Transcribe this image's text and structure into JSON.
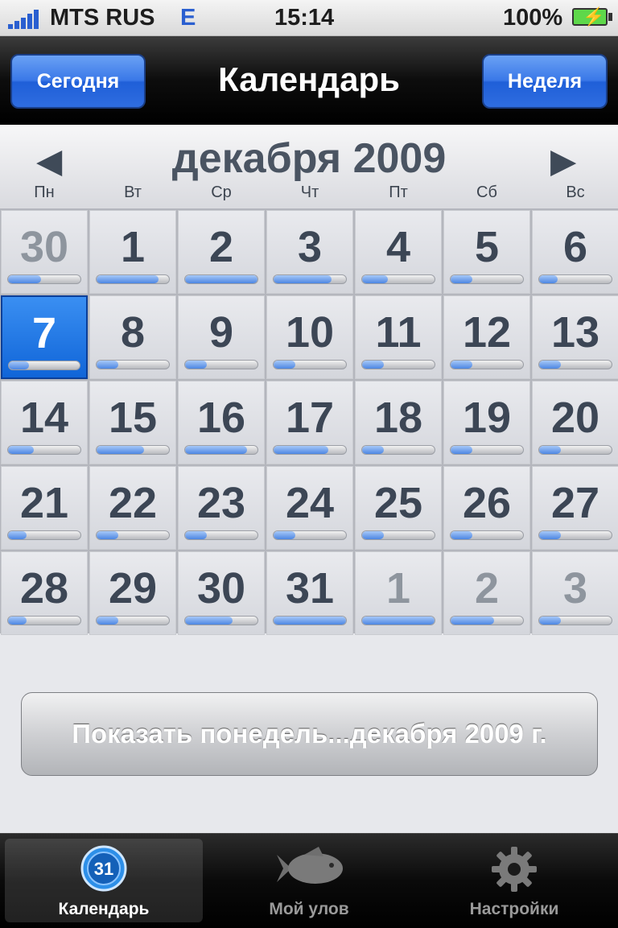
{
  "status": {
    "carrier": "MTS RUS",
    "network": "E",
    "time": "15:14",
    "battery": "100%"
  },
  "nav": {
    "title": "Календарь",
    "left_button": "Сегодня",
    "right_button": "Неделя"
  },
  "calendar": {
    "month_label": "декабря 2009",
    "weekdays": [
      "Пн",
      "Вт",
      "Ср",
      "Чт",
      "Пт",
      "Сб",
      "Вс"
    ],
    "weeks": [
      [
        {
          "day": "30",
          "other": true,
          "level": 0.45
        },
        {
          "day": "1",
          "level": 0.85
        },
        {
          "day": "2",
          "level": 1.0
        },
        {
          "day": "3",
          "level": 0.8
        },
        {
          "day": "4",
          "level": 0.35
        },
        {
          "day": "5",
          "level": 0.3
        },
        {
          "day": "6",
          "level": 0.25
        }
      ],
      [
        {
          "day": "7",
          "selected": true,
          "level": 0.28
        },
        {
          "day": "8",
          "level": 0.3
        },
        {
          "day": "9",
          "level": 0.3
        },
        {
          "day": "10",
          "level": 0.3
        },
        {
          "day": "11",
          "level": 0.3
        },
        {
          "day": "12",
          "level": 0.3
        },
        {
          "day": "13",
          "level": 0.3
        }
      ],
      [
        {
          "day": "14",
          "level": 0.35
        },
        {
          "day": "15",
          "level": 0.65
        },
        {
          "day": "16",
          "level": 0.85
        },
        {
          "day": "17",
          "level": 0.75
        },
        {
          "day": "18",
          "level": 0.3
        },
        {
          "day": "19",
          "level": 0.3
        },
        {
          "day": "20",
          "level": 0.3
        }
      ],
      [
        {
          "day": "21",
          "level": 0.25
        },
        {
          "day": "22",
          "level": 0.3
        },
        {
          "day": "23",
          "level": 0.3
        },
        {
          "day": "24",
          "level": 0.3
        },
        {
          "day": "25",
          "level": 0.3
        },
        {
          "day": "26",
          "level": 0.3
        },
        {
          "day": "27",
          "level": 0.3
        }
      ],
      [
        {
          "day": "28",
          "level": 0.25
        },
        {
          "day": "29",
          "level": 0.3
        },
        {
          "day": "30",
          "level": 0.65
        },
        {
          "day": "31",
          "level": 1.0
        },
        {
          "day": "1",
          "other": true,
          "level": 1.0
        },
        {
          "day": "2",
          "other": true,
          "level": 0.6
        },
        {
          "day": "3",
          "other": true,
          "level": 0.3
        }
      ]
    ]
  },
  "show_week_button": "Показать понедель...декабря 2009 г.",
  "tabs": [
    {
      "label": "Календарь",
      "icon": "calendar-31-icon",
      "icon_text": "31",
      "active": true
    },
    {
      "label": "Мой улов",
      "icon": "fish-icon",
      "active": false
    },
    {
      "label": "Настройки",
      "icon": "gear-icon",
      "active": false
    }
  ],
  "colors": {
    "accent": "#1f6ad8",
    "nav_bg": "#000000",
    "grid_bg": "#e7e8ec"
  }
}
